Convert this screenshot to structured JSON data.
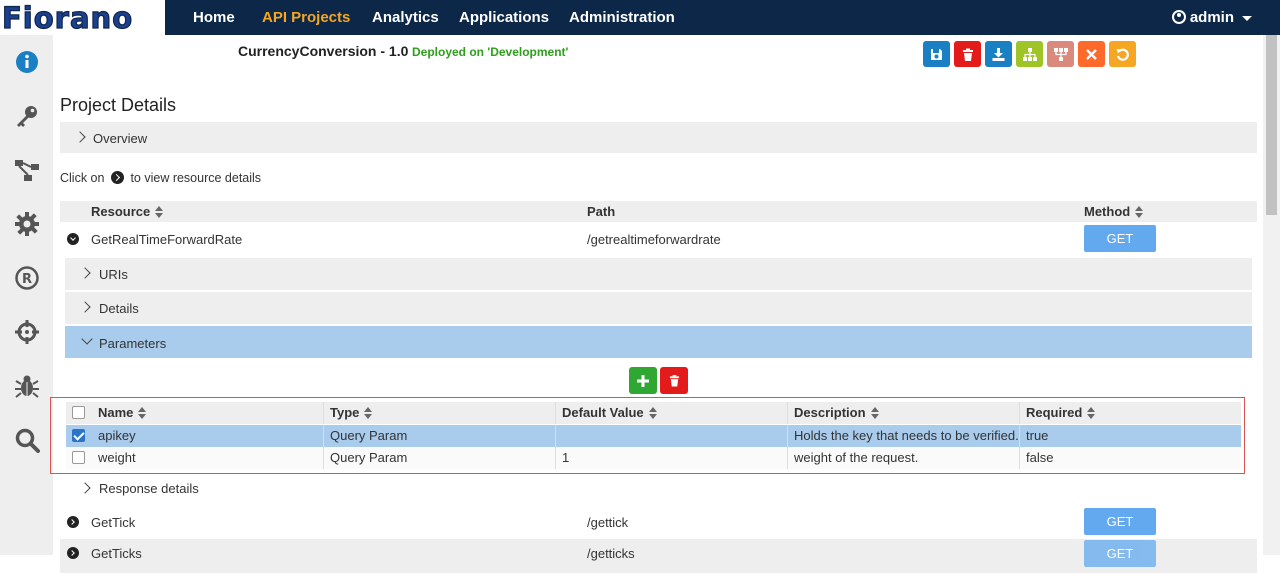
{
  "brand": {
    "logo": "Fiorano"
  },
  "nav": {
    "items": [
      "Home",
      "API Projects",
      "Analytics",
      "Applications",
      "Administration"
    ],
    "active": "API Projects",
    "user": "admin"
  },
  "sidebar": {
    "icons": [
      "info-icon",
      "key-icon",
      "flow-icon",
      "gear-icon",
      "registered-icon",
      "crosshair-icon",
      "bug-icon",
      "search-icon"
    ]
  },
  "project": {
    "title": "CurrencyConversion - 1.0",
    "status": "Deployed on 'Development'"
  },
  "toolbar": {
    "buttons": [
      {
        "icon": "save-icon",
        "color": "#1b7fc4"
      },
      {
        "icon": "trash-icon",
        "color": "#e31b1b"
      },
      {
        "icon": "download-icon",
        "color": "#1b7fc4"
      },
      {
        "icon": "hierarchy-icon",
        "color": "#9fc427"
      },
      {
        "icon": "hierarchy-alt-icon",
        "color": "#d98a7c"
      },
      {
        "icon": "close-icon",
        "color": "#ff6a2a"
      },
      {
        "icon": "undo-icon",
        "color": "#f5a623"
      }
    ]
  },
  "main": {
    "page_title": "Project Details",
    "overview_label": "Overview",
    "hint_prefix": "Click on",
    "hint_suffix": "to view resource details",
    "resource_headers": {
      "resource": "Resource",
      "path": "Path",
      "method": "Method"
    },
    "resources": [
      {
        "name": "GetRealTimeForwardRate",
        "path": "/getrealtimeforwardrate",
        "method": "GET"
      },
      {
        "name": "GetTick",
        "path": "/gettick",
        "method": "GET"
      },
      {
        "name": "GetTicks",
        "path": "/getticks",
        "method": "GET"
      }
    ],
    "sub_sections": {
      "uris": "URIs",
      "details": "Details",
      "parameters": "Parameters",
      "response": "Response details"
    },
    "param_headers": {
      "name": "Name",
      "type": "Type",
      "default": "Default Value",
      "description": "Description",
      "required": "Required"
    },
    "params": [
      {
        "name": "apikey",
        "type": "Query Param",
        "default": "",
        "description": "Holds the key that needs to be verified.",
        "required": "true",
        "checked": true
      },
      {
        "name": "weight",
        "type": "Query Param",
        "default": "1",
        "description": "weight of the request.",
        "required": "false",
        "checked": false
      }
    ]
  }
}
